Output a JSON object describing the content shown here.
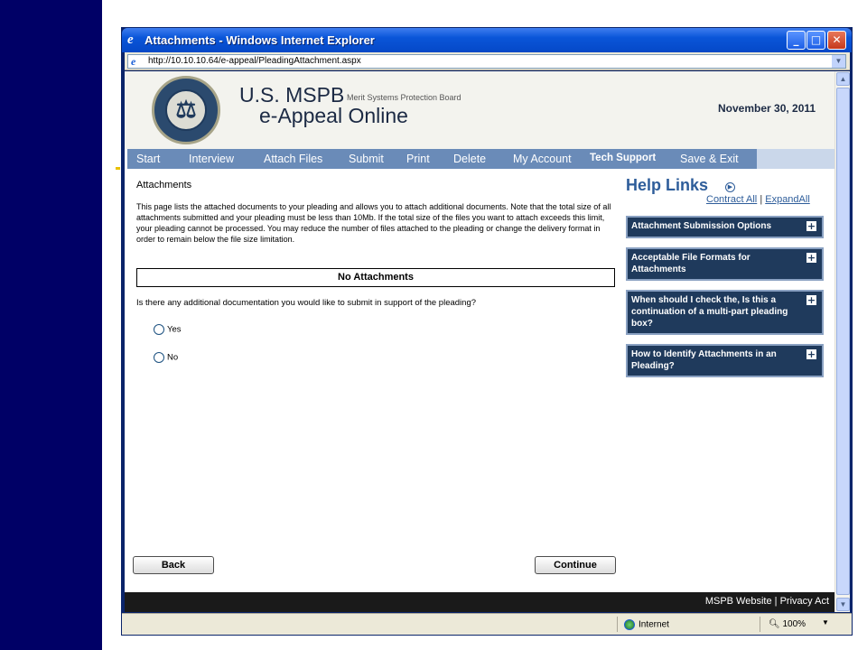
{
  "window": {
    "title": "Attachments - Windows Internet Explorer",
    "address": "http://10.10.10.64/e-appeal/PleadingAttachment.aspx"
  },
  "header": {
    "seal_symbol": "⚖",
    "brand_main": "U.S. MSPB",
    "brand_sub": "Merit Systems Protection Board",
    "brand_product": "e-Appeal Online",
    "date": "November 30, 2011"
  },
  "nav": {
    "items": [
      "Start",
      "Interview",
      "Attach Files",
      "Submit",
      "Print",
      "Delete",
      "My Account",
      "Tech Support",
      "Save & Exit"
    ]
  },
  "main": {
    "title": "Attachments",
    "description": "This page lists the attached documents to your pleading and allows you to attach additional documents. Note that the total size of all attachments submitted and your pleading must be less than 10Mb. If the total size of the files you want to attach exceeds this limit, your pleading cannot be processed. You may reduce the number of files attached to the pleading or change the delivery format in order to remain below the file size limitation.",
    "no_attachments": "No Attachments",
    "question": "Is there any additional documentation you would like to submit in support of the pleading?",
    "options": [
      "Yes",
      "No"
    ],
    "back_label": "Back",
    "continue_label": "Continue"
  },
  "help": {
    "title": "Help Links",
    "contract_all": "Contract All",
    "separator": "|",
    "expand_all": "ExpandAll",
    "items": [
      "Attachment Submission Options",
      "Acceptable File Formats for Attachments",
      "When should I check the, Is this a continuation of a multi-part pleading box?",
      "How to Identify Attachments in an Pleading?"
    ]
  },
  "footer": {
    "website": "MSPB Website",
    "separator": "|",
    "privacy": "Privacy Act"
  },
  "status": {
    "zone": "Internet",
    "zoom": "100%"
  },
  "colors": {
    "slide_band": "#000066",
    "nav_bg": "#6a8bb8",
    "help_box_bg": "#1f3a5c",
    "help_title": "#2e5d9a"
  }
}
